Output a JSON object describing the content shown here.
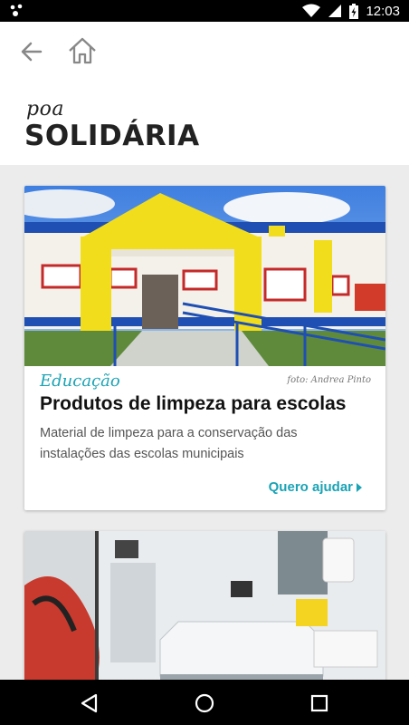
{
  "status_bar": {
    "time": "12:03",
    "icons": [
      "notification-dots-icon",
      "wifi-icon",
      "signal-icon",
      "battery-icon"
    ]
  },
  "header": {
    "icons": [
      "back-arrow-icon",
      "home-icon"
    ],
    "logo_small": "poa",
    "logo_big": "SOLIDÁRIA"
  },
  "cards": [
    {
      "category": "Educação",
      "photo_credit": "foto: Andrea Pinto",
      "title": "Produtos de limpeza para escolas",
      "description": "Material de limpeza para a conservação das instalações das escolas municipais",
      "action_label": "Quero ajudar"
    }
  ],
  "colors": {
    "accent": "#1aa3b5",
    "background": "#ececec",
    "building_yellow": "#f2dd1c",
    "building_blue": "#1f4fb3"
  },
  "nav_bar": {
    "icons": [
      "back-triangle-icon",
      "home-circle-icon",
      "recents-square-icon"
    ]
  }
}
